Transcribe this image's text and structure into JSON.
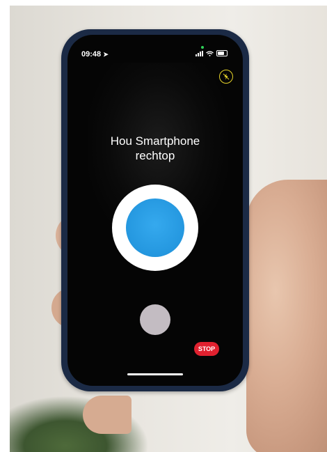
{
  "status_bar": {
    "time": "09:48",
    "location_icon": "location-arrow-icon",
    "signal_icon": "cellular-signal-icon",
    "wifi_icon": "wifi-icon",
    "battery_icon": "battery-icon"
  },
  "flash_toggle": {
    "icon": "flash-off-icon",
    "color": "#e6d32a"
  },
  "instruction": {
    "line1": "Hou Smartphone",
    "line2": "rechtop"
  },
  "level_indicator": {
    "outer_color": "#ffffff",
    "inner_color": "#2497df"
  },
  "secondary_button": {
    "color": "#c3bcc2"
  },
  "stop_button": {
    "label": "STOP",
    "color": "#e0212f"
  }
}
